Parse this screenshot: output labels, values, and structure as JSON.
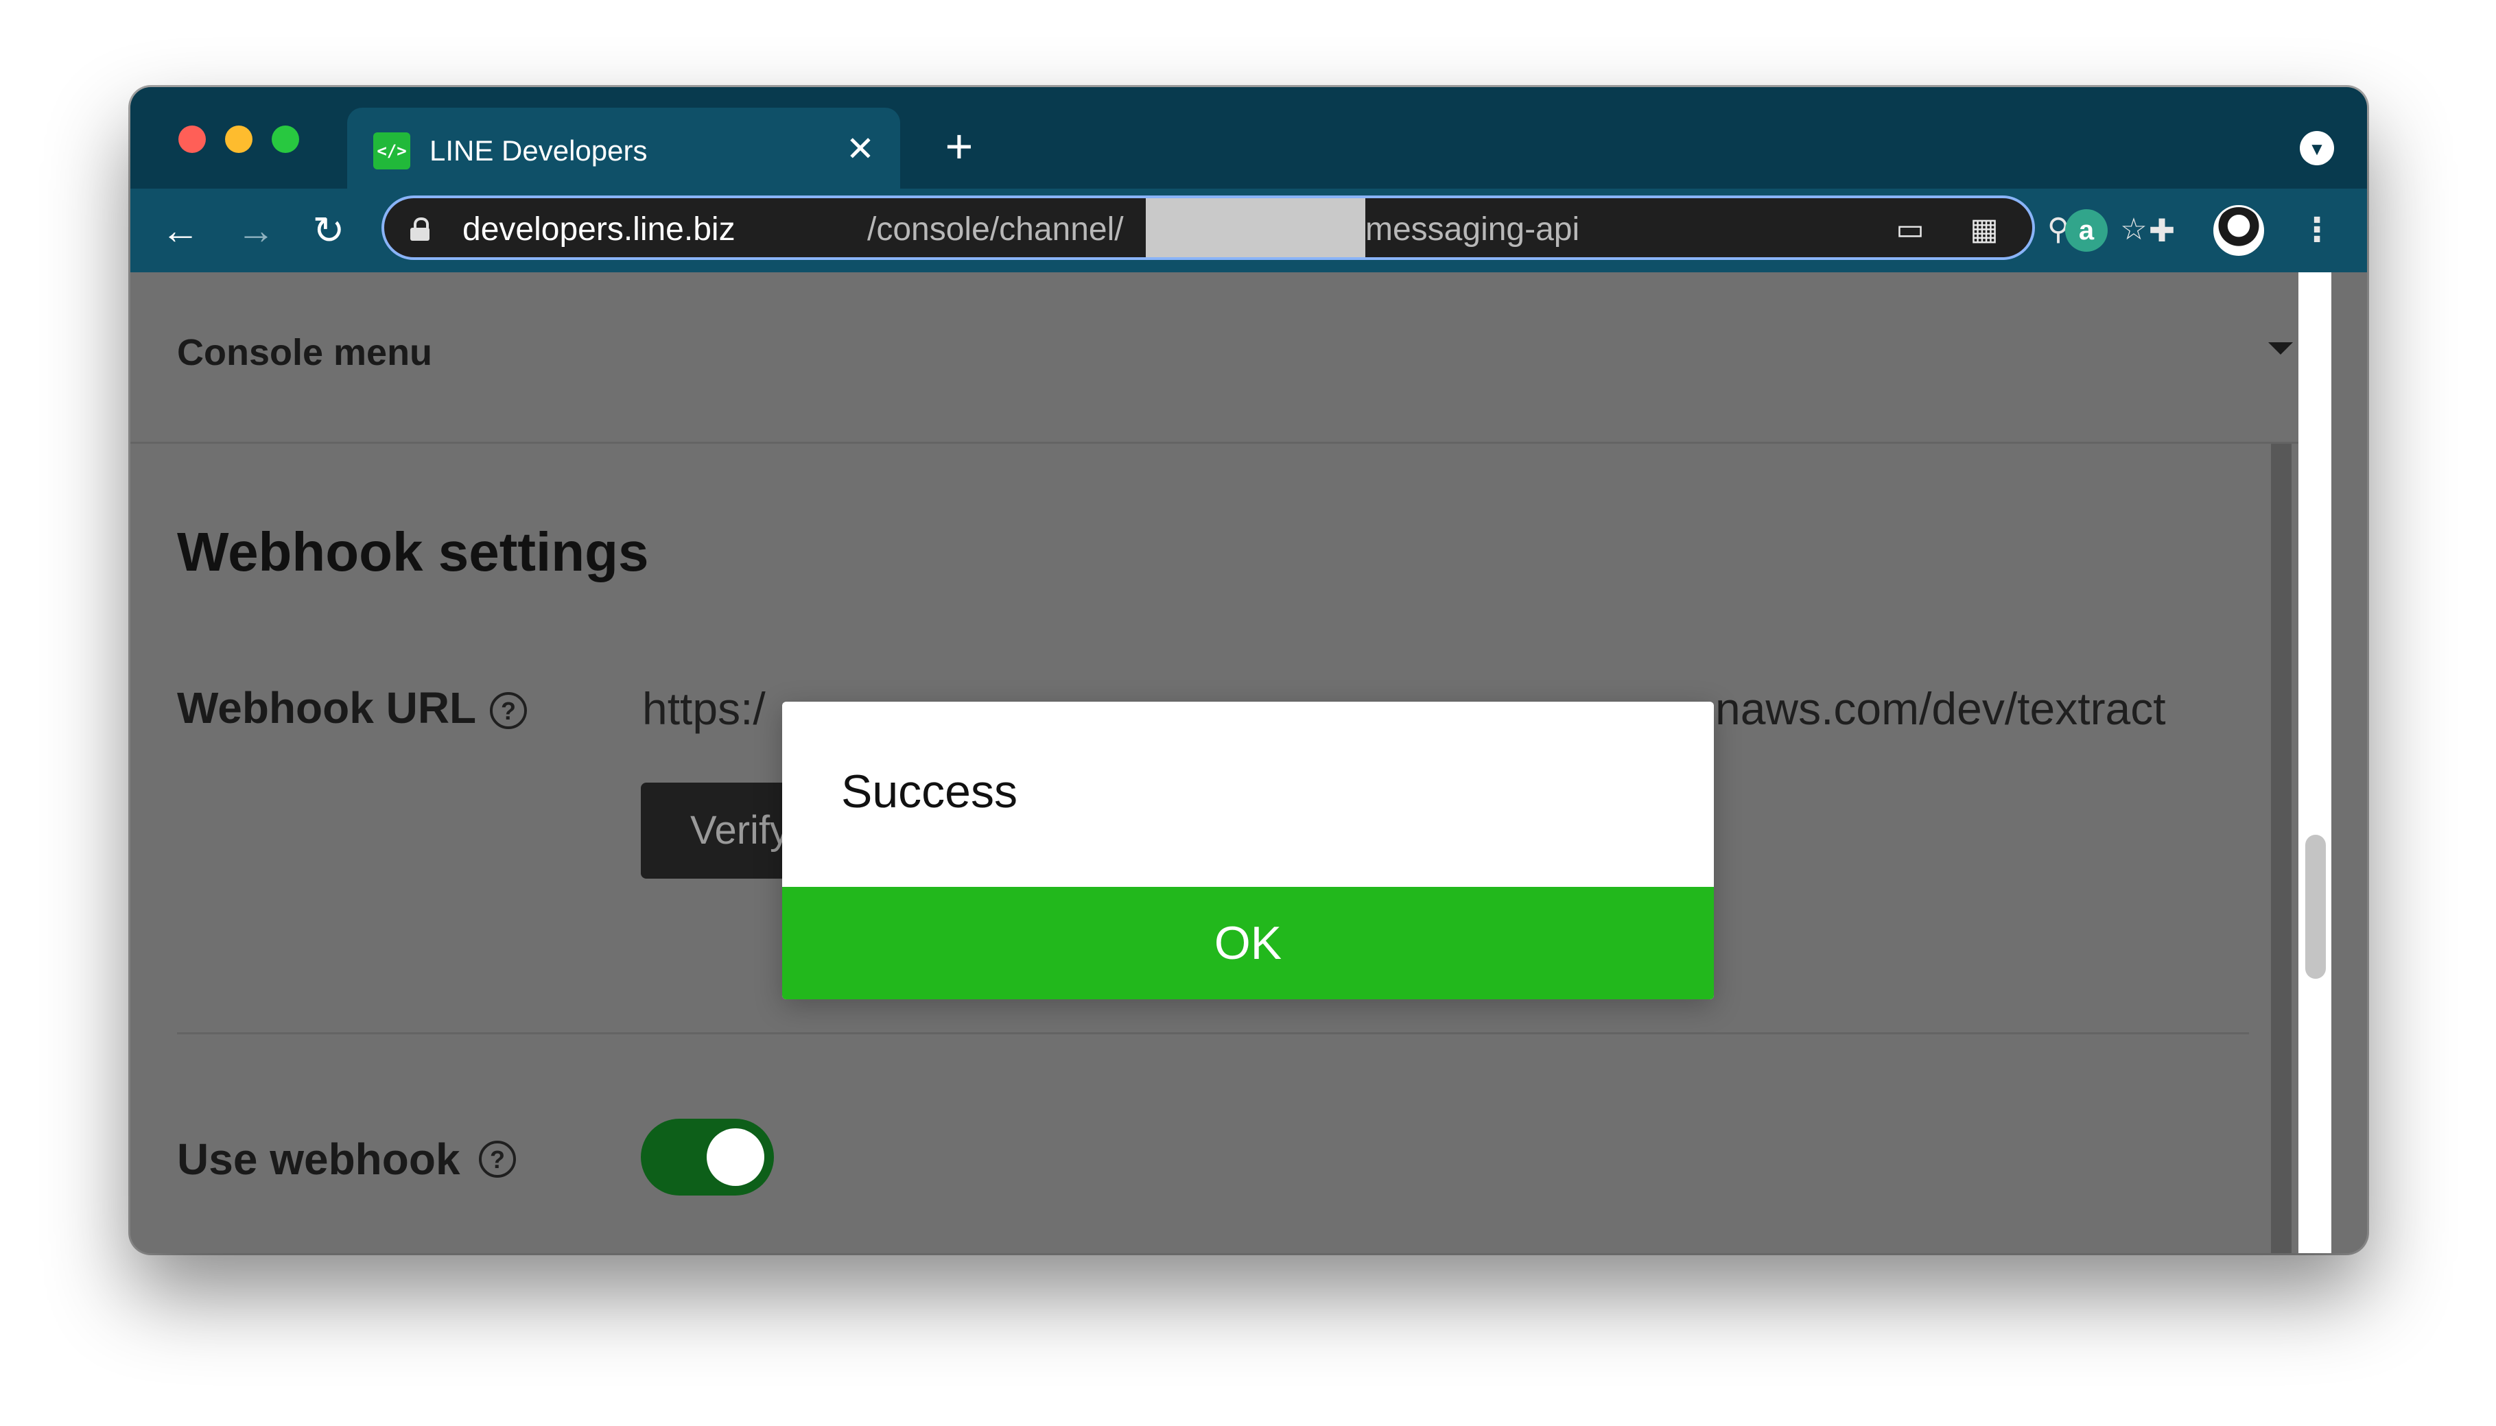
{
  "browser": {
    "tab": {
      "favicon": "</>",
      "title": "LINE Developers",
      "close": "✕"
    },
    "new_tab": "+",
    "tab_menu_icon": "chevron-down-icon",
    "nav": {
      "back": "←",
      "forward": "→",
      "reload": "↻"
    },
    "address": {
      "host": "developers.line.biz",
      "path_before": "/console/channel/",
      "path_after": "messaging-api"
    },
    "omnibox_icons": {
      "cast": "▭",
      "qr": "▦",
      "zoom": "⚲",
      "star": "☆"
    },
    "extensions": {
      "amazon": "a",
      "puzzle": "✚",
      "kebab": "⋮"
    }
  },
  "page": {
    "console_menu": "Console menu",
    "section_title": "Webhook settings",
    "webhook_url": {
      "label": "Webhook URL",
      "help": "?",
      "value_start": "https:/",
      "value_end": "naws.com/dev/textract",
      "verify_label": "Verify"
    },
    "use_webhook": {
      "label": "Use webhook",
      "help": "?",
      "enabled": true
    }
  },
  "dialog": {
    "message": "Success",
    "ok_label": "OK",
    "ok_color": "#22b81c"
  }
}
